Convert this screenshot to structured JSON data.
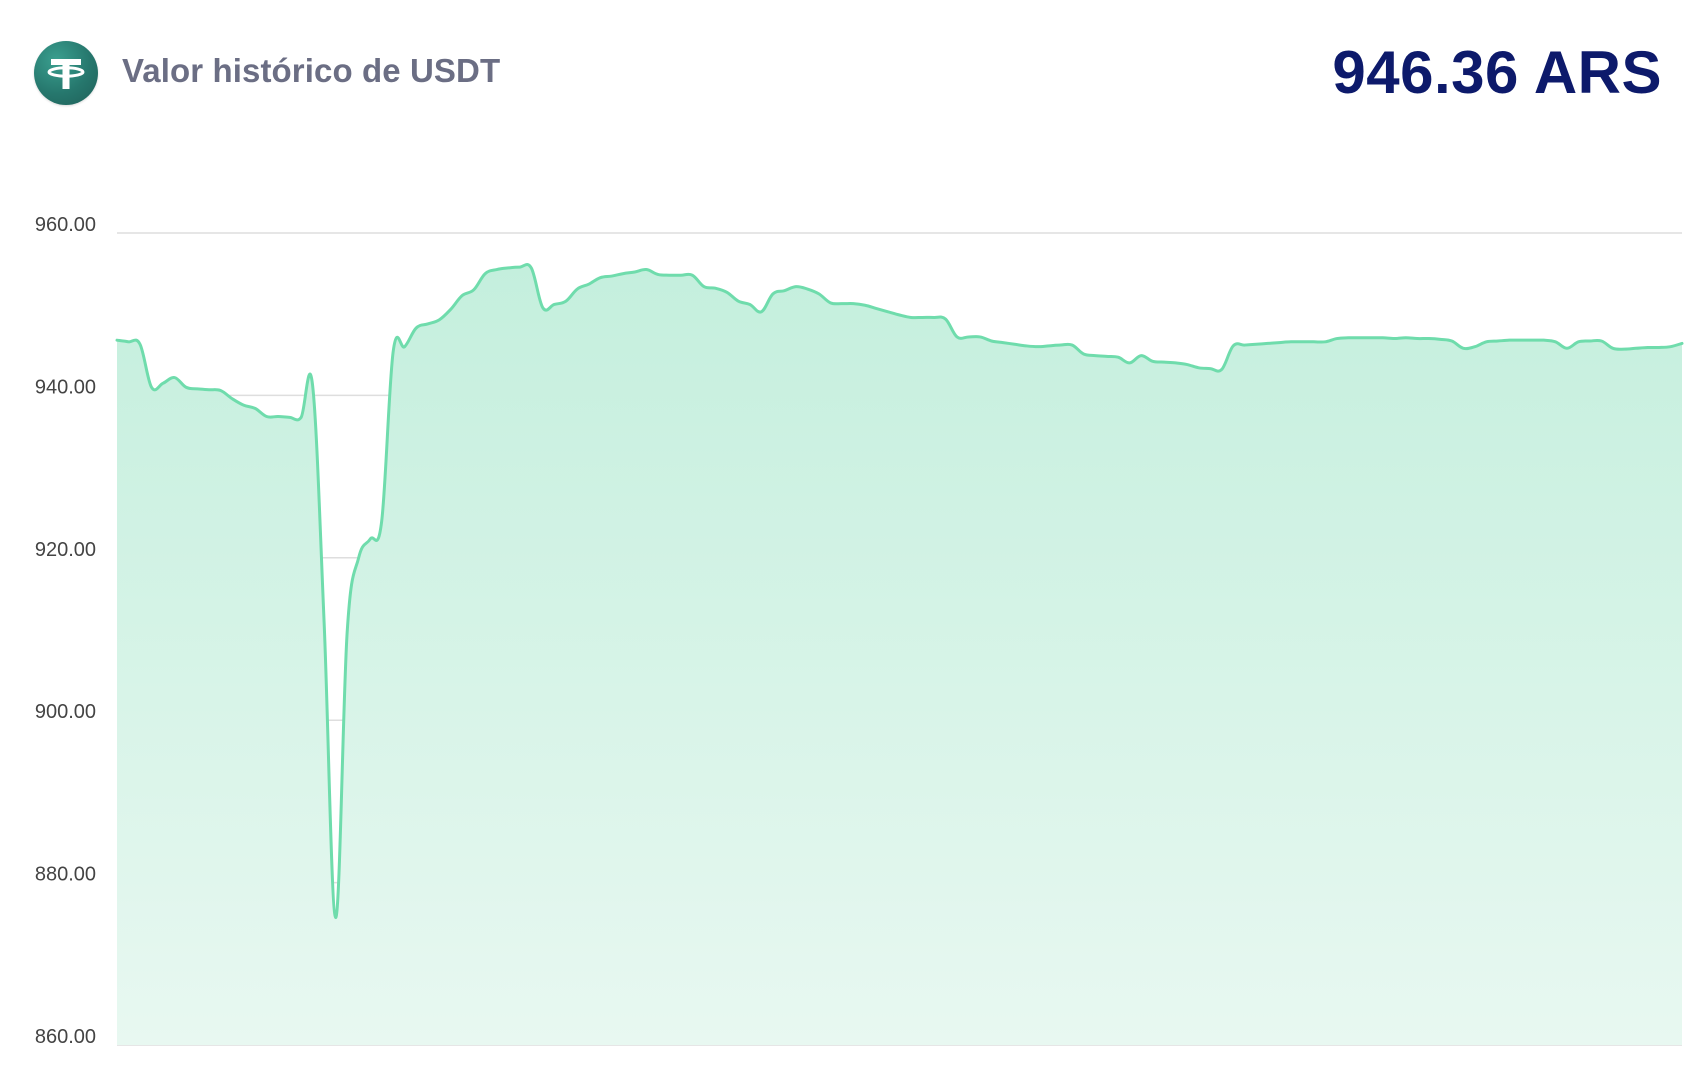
{
  "header": {
    "title": "Valor histórico de USDT",
    "price": "946.36 ARS",
    "logo_icon": "tether-logo-icon"
  },
  "colors": {
    "line": "#6fdcac",
    "fill_top": "#c4efdd",
    "fill_bottom": "#e8f8f1",
    "gridline": "#dedede",
    "title": "#6b6e84",
    "price": "#0d1a6b",
    "logo": "#26776d"
  },
  "chart_data": {
    "type": "area",
    "title": "",
    "xlabel": "",
    "ylabel": "",
    "ylim": [
      860,
      960
    ],
    "y_ticks": [
      "960.00",
      "940.00",
      "920.00",
      "900.00",
      "880.00",
      "860.00"
    ],
    "y_tick_values": [
      960,
      940,
      920,
      900,
      880,
      860
    ],
    "grid": true,
    "legend": "none",
    "x_label_shown": false,
    "series": [
      {
        "values": [
          946.8,
          946.6,
          946.3,
          941.0,
          941.5,
          942.2,
          941.0,
          940.8,
          940.7,
          940.6,
          939.6,
          938.8,
          938.4,
          937.4,
          937.4,
          937.3,
          937.3,
          941.2,
          912.0,
          875.7,
          910.8,
          920.0,
          922.3,
          924.5,
          945.4,
          946.0,
          948.3,
          948.8,
          949.3,
          950.6,
          952.3,
          953.0,
          955.0,
          955.5,
          955.7,
          955.8,
          955.7,
          950.8,
          951.2,
          951.6,
          953.1,
          953.7,
          954.5,
          954.7,
          955.0,
          955.2,
          955.5,
          954.9,
          954.8,
          954.8,
          954.8,
          953.4,
          953.2,
          952.7,
          951.6,
          951.2,
          950.3,
          952.5,
          952.9,
          953.4,
          953.1,
          952.5,
          951.4,
          951.3,
          951.3,
          951.1,
          950.7,
          950.3,
          949.9,
          949.6,
          949.6,
          949.6,
          949.4,
          947.2,
          947.2,
          947.2,
          946.7,
          946.5,
          946.3,
          946.1,
          946.0,
          946.1,
          946.2,
          946.2,
          945.1,
          944.9,
          944.8,
          944.7,
          944.0,
          944.9,
          944.2,
          944.1,
          944.0,
          943.8,
          943.4,
          943.3,
          943.2,
          946.1,
          946.2,
          946.3,
          946.4,
          946.5,
          946.6,
          946.6,
          946.6,
          946.6,
          947.0,
          947.1,
          947.1,
          947.1,
          947.1,
          947.0,
          947.1,
          947.0,
          947.0,
          946.9,
          946.7,
          945.8,
          946.0,
          946.6,
          946.7,
          946.8,
          946.8,
          946.8,
          946.8,
          946.6,
          945.8,
          946.6,
          946.7,
          946.7,
          945.8,
          945.7,
          945.8,
          945.9,
          945.9,
          946.0,
          946.4
        ]
      }
    ]
  }
}
